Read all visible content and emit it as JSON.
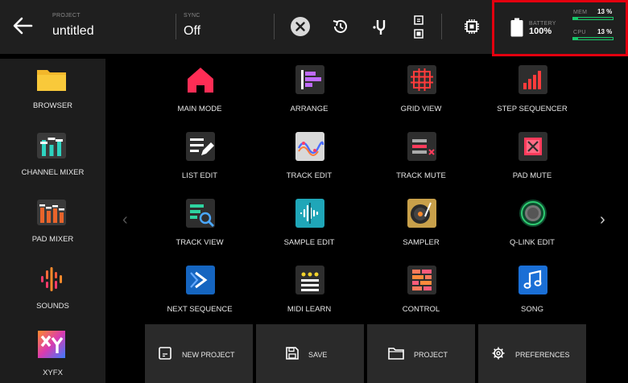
{
  "header": {
    "project_label": "PROJECT",
    "project_name": "untitled",
    "sync_label": "SYNC",
    "sync_value": "Off",
    "battery_label": "BATTERY",
    "battery_value": "100%",
    "mem_label": "MEM",
    "mem_value": "13 %",
    "mem_fraction": 0.13,
    "cpu_label": "CPU",
    "cpu_value": "13 %",
    "cpu_fraction": 0.13,
    "icons": [
      "back-arrow-icon",
      "close-circle-icon",
      "history-icon",
      "tuning-fork-icon",
      "pad-toggle-icon",
      "chip-icon",
      "battery-icon"
    ]
  },
  "sidebar": {
    "items": [
      {
        "label": "BROWSER",
        "icon": "folder-icon"
      },
      {
        "label": "CHANNEL MIXER",
        "icon": "channel-mixer-icon"
      },
      {
        "label": "PAD MIXER",
        "icon": "pad-mixer-icon"
      },
      {
        "label": "SOUNDS",
        "icon": "sounds-icon"
      },
      {
        "label": "XYFX",
        "icon": "xyfx-icon"
      }
    ]
  },
  "grid": {
    "items": [
      {
        "label": "MAIN MODE",
        "icon": "home-icon"
      },
      {
        "label": "ARRANGE",
        "icon": "arrange-icon"
      },
      {
        "label": "GRID VIEW",
        "icon": "grid-view-icon"
      },
      {
        "label": "STEP SEQUENCER",
        "icon": "step-sequencer-icon"
      },
      {
        "label": "LIST EDIT",
        "icon": "list-edit-icon"
      },
      {
        "label": "TRACK EDIT",
        "icon": "track-edit-icon"
      },
      {
        "label": "TRACK MUTE",
        "icon": "track-mute-icon"
      },
      {
        "label": "PAD MUTE",
        "icon": "pad-mute-icon"
      },
      {
        "label": "TRACK VIEW",
        "icon": "track-view-icon"
      },
      {
        "label": "SAMPLE EDIT",
        "icon": "sample-edit-icon"
      },
      {
        "label": "SAMPLER",
        "icon": "sampler-icon"
      },
      {
        "label": "Q-LINK EDIT",
        "icon": "q-link-icon"
      },
      {
        "label": "NEXT SEQUENCE",
        "icon": "next-sequence-icon"
      },
      {
        "label": "MIDI LEARN",
        "icon": "midi-learn-icon"
      },
      {
        "label": "CONTROL",
        "icon": "control-icon"
      },
      {
        "label": "SONG",
        "icon": "song-icon"
      }
    ]
  },
  "bottom": {
    "new_project": "NEW PROJECT",
    "save": "SAVE",
    "project": "PROJECT",
    "preferences": "PREFERENCES"
  },
  "nav": {
    "prev": "‹",
    "next": "›"
  },
  "colors": {
    "accent_highlight": "#e3000f",
    "meter_green": "#18c66a"
  }
}
